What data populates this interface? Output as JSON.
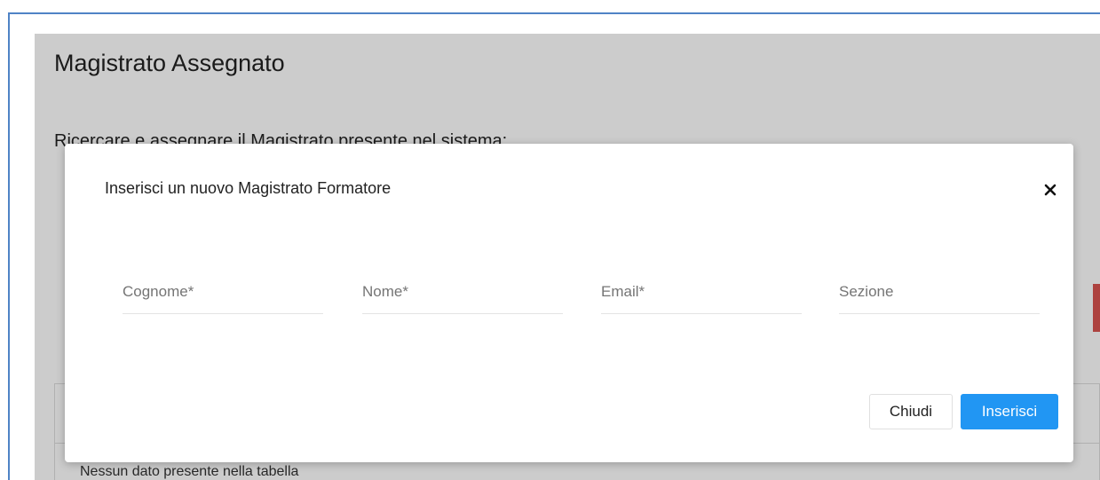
{
  "page": {
    "title": "Magistrato Assegnato",
    "subtitle": "Ricercare e assegnare il Magistrato presente nel sistema:",
    "table_empty_message": "Nessun dato presente nella tabella"
  },
  "modal": {
    "title": "Inserisci un nuovo Magistrato Formatore",
    "close_icon": "close-icon",
    "fields": [
      {
        "placeholder": "Cognome*",
        "value": ""
      },
      {
        "placeholder": "Nome*",
        "value": ""
      },
      {
        "placeholder": "Email*",
        "value": ""
      },
      {
        "placeholder": "Sezione",
        "value": ""
      }
    ],
    "buttons": {
      "close_label": "Chiudi",
      "insert_label": "Inserisci"
    }
  },
  "colors": {
    "primary": "#2196f3",
    "frame_border": "#4f83c6",
    "accent_red": "#d9534f"
  }
}
